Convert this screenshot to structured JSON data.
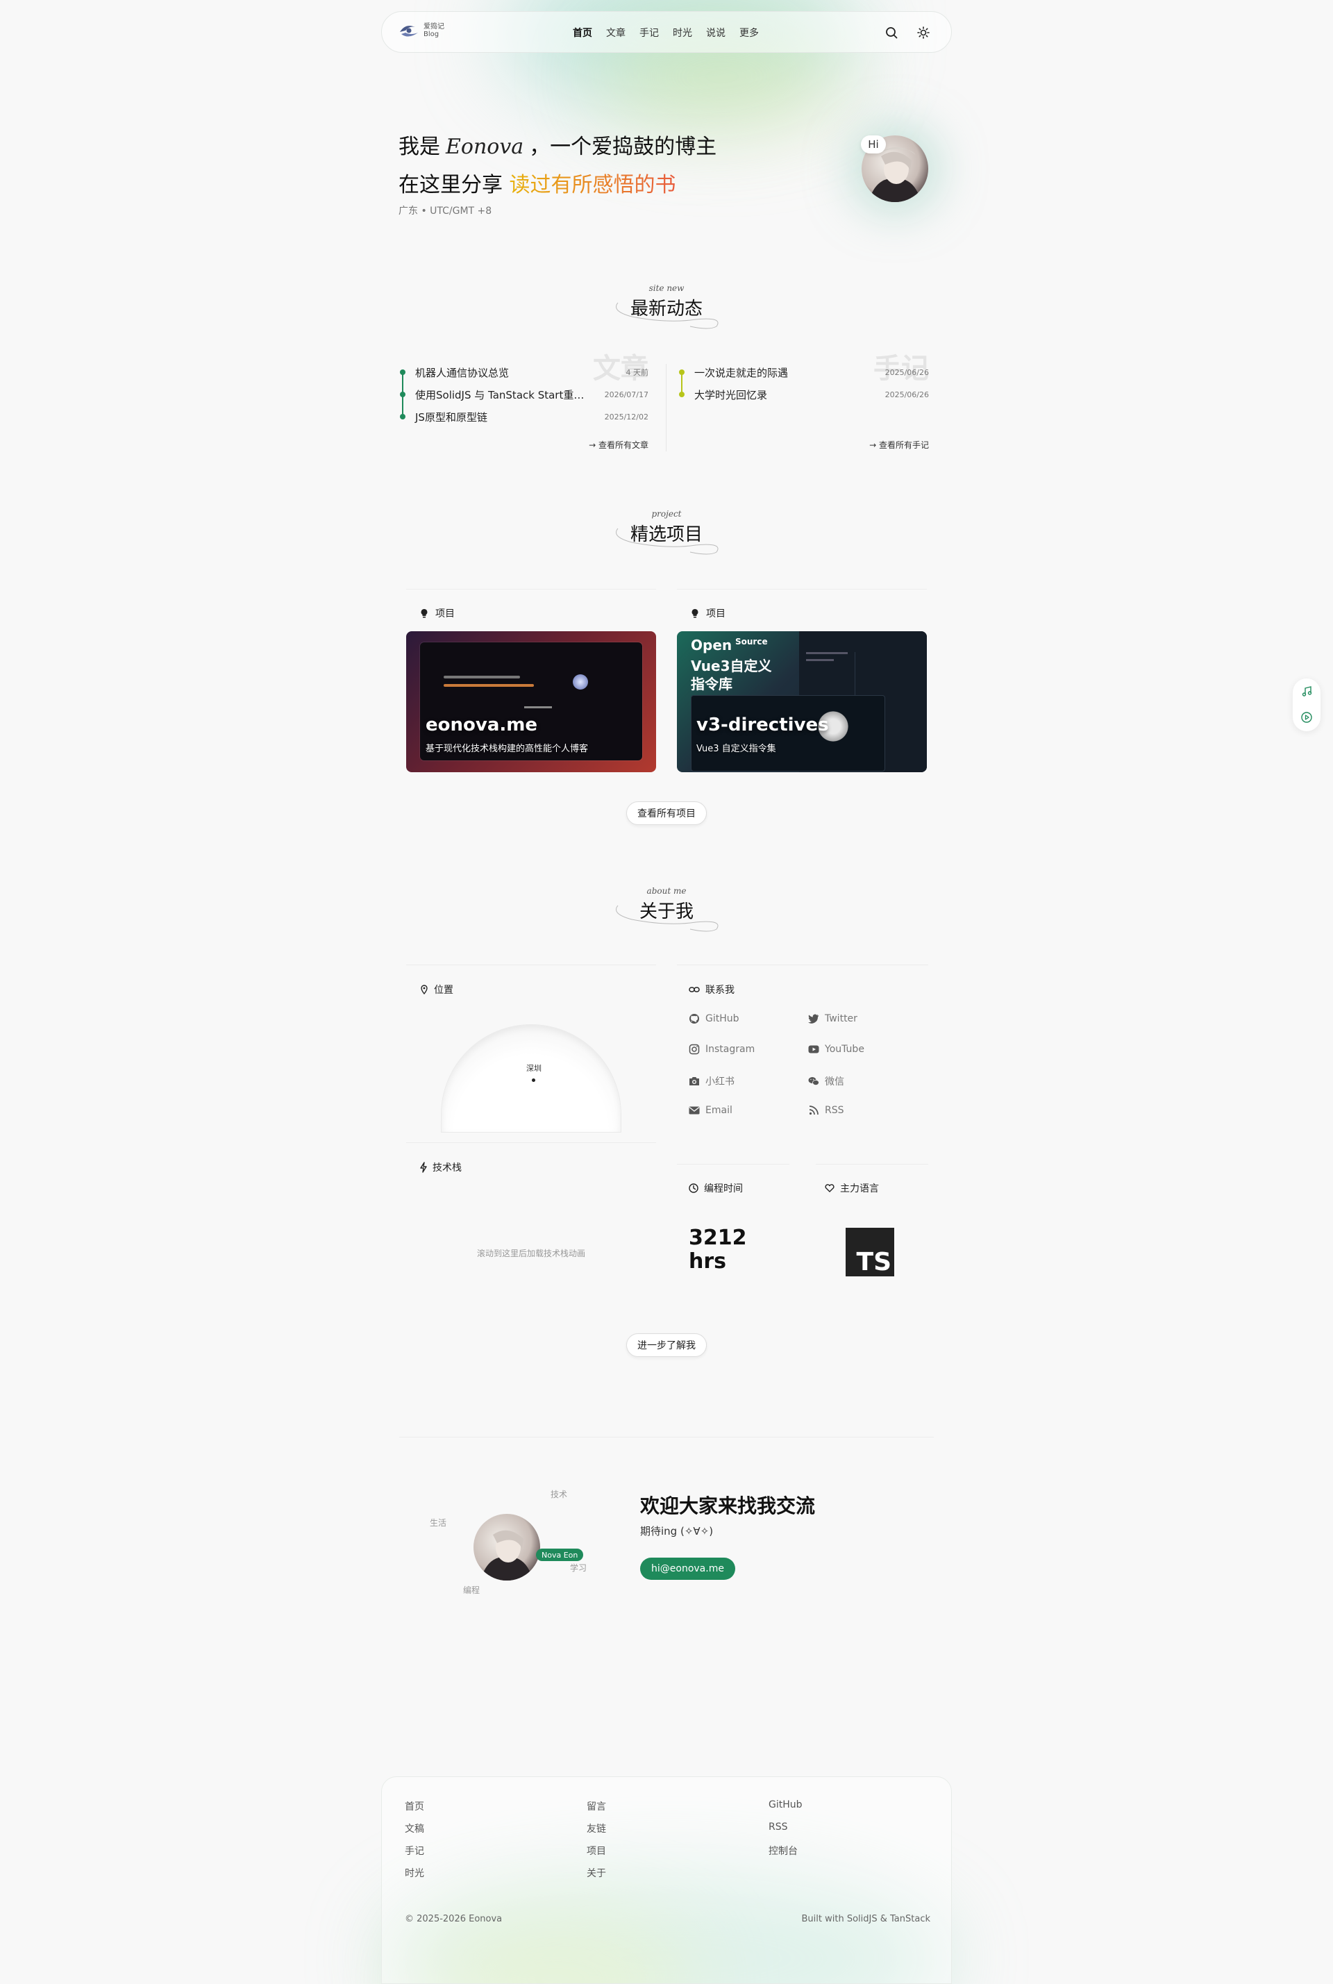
{
  "nav": {
    "logo_line1": "爱捣记",
    "logo_line2": "Blog",
    "items": [
      "首页",
      "文章",
      "手记",
      "时光",
      "说说",
      "更多"
    ],
    "active_index": 0
  },
  "hero": {
    "line1_prefix": "我是",
    "signature": "Eonova",
    "line1_suffix": "，一个爱捣鼓的博主",
    "line2_prefix": "在这里分享",
    "line2_highlight": "读过有所感悟的书",
    "location": "广东 • UTC/GMT +8",
    "hi": "Hi"
  },
  "updates": {
    "subtitle": "site new",
    "title": "最新动态",
    "articles": {
      "watermark": "文章",
      "items": [
        {
          "title": "机器人通信协议总览",
          "date": "4 天前"
        },
        {
          "title": "使用SolidJS 与 TanStack Start重构博客",
          "date": "2026/07/17"
        },
        {
          "title": "JS原型和原型链",
          "date": "2025/12/02"
        }
      ],
      "see_all": "查看所有文章"
    },
    "notes": {
      "watermark": "手记",
      "items": [
        {
          "title": "一次说走就走的际遇",
          "date": "2025/06/26"
        },
        {
          "title": "大学时光回忆录",
          "date": "2025/06/26"
        }
      ],
      "see_all": "查看所有手记"
    }
  },
  "projects": {
    "subtitle": "project",
    "title": "精选项目",
    "cards": [
      {
        "label": "项目",
        "name": "eonova.me",
        "desc": "基于现代化技术栈构建的高性能个人博客"
      },
      {
        "label": "项目",
        "name": "v3-directives",
        "desc": "Vue3 自定义指令集",
        "cover_title_1": "Open",
        "cover_title_2": "Vue3自定义",
        "cover_title_3": "指令库",
        "cover_tag": "Source"
      }
    ],
    "see_all": "查看所有项目"
  },
  "about": {
    "subtitle": "about me",
    "title": "关于我",
    "location_head": "位置",
    "city": "深圳",
    "contact_head": "联系我",
    "socials": [
      {
        "name": "GitHub",
        "icon": "github-icon"
      },
      {
        "name": "Twitter",
        "icon": "twitter-icon"
      },
      {
        "name": "Instagram",
        "icon": "instagram-icon"
      },
      {
        "name": "YouTube",
        "icon": "youtube-icon"
      },
      {
        "name": "小红书",
        "icon": "camera-icon"
      },
      {
        "name": "微信",
        "icon": "wechat-icon"
      },
      {
        "name": "Email",
        "icon": "mail-icon"
      },
      {
        "name": "RSS",
        "icon": "rss-icon"
      }
    ],
    "stack_head": "技术栈",
    "stack_hint": "滚动到这里后加载技术栈动画",
    "coding_head": "编程时间",
    "coding_value": "3212",
    "coding_unit": "hrs",
    "lang_head": "主力语言",
    "lang_badge": "TS",
    "more": "进一步了解我"
  },
  "contact": {
    "tags": [
      "技术",
      "生活",
      "学习",
      "编程"
    ],
    "name_badge": "Nova Eon",
    "title": "欢迎大家来找我交流",
    "subtitle": "期待ing (✧∀✧)",
    "email": "hi@eonova.me"
  },
  "footer": {
    "col1": [
      "首页",
      "文稿",
      "手记",
      "时光"
    ],
    "col2": [
      "留言",
      "友链",
      "项目",
      "关于"
    ],
    "col3": [
      "GitHub",
      "RSS",
      "控制台"
    ],
    "copyright": "© 2025-2026 Eonova",
    "built": "Built with SolidJS & TanStack"
  },
  "colors": {
    "accent": "#1f8a5b",
    "timeline_article": "#1f8a5b",
    "timeline_note": "#b7c51a"
  }
}
